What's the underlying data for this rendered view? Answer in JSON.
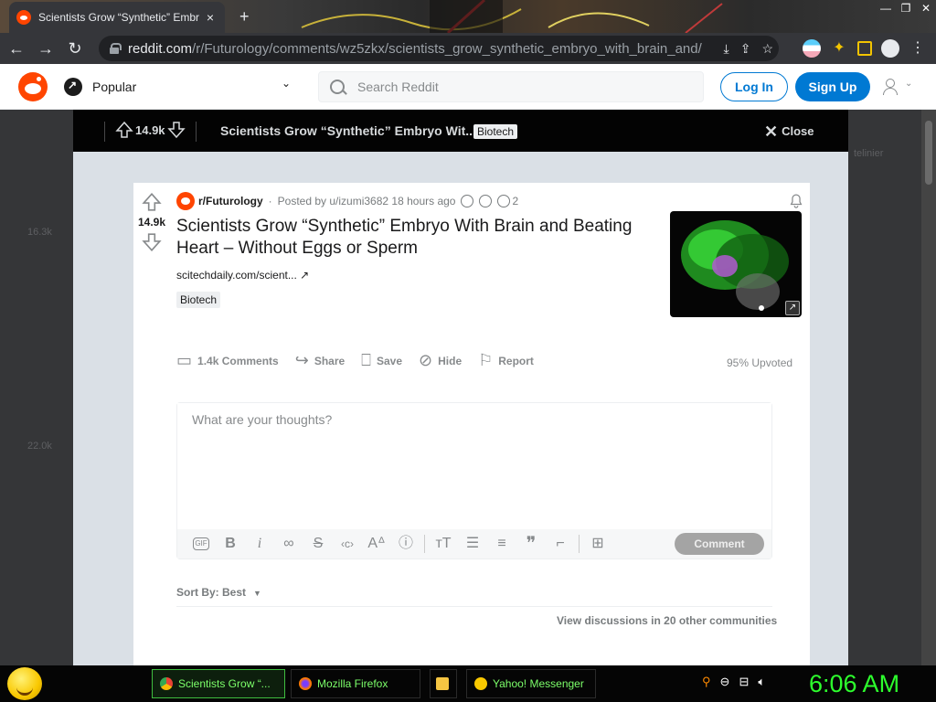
{
  "browser": {
    "tab_title": "Scientists Grow “Synthetic” Embr",
    "tab_close": "×",
    "new_tab": "+",
    "url_host": "reddit.com",
    "url_path": "/r/Futurology/comments/wz5zkx/scientists_grow_synthetic_embryo_with_brain_and/",
    "window_controls": [
      "—",
      "❐",
      "✕"
    ]
  },
  "header": {
    "feed_label": "Popular",
    "search_placeholder": "Search Reddit",
    "login": "Log In",
    "signup": "Sign Up"
  },
  "overlay": {
    "score": "14.9k",
    "title": "Scientists Grow “Synthetic” Embryo Wit...",
    "flair": "Biotech",
    "close": "Close"
  },
  "post": {
    "score": "14.9k",
    "subreddit": "r/Futurology",
    "posted_by": "Posted by u/izumi3682 18 hours ago",
    "award_count": "2",
    "title": "Scientists Grow “Synthetic” Embryo With Brain and Beating Heart – Without Eggs or Sperm",
    "link": "scitechdaily.com/scient...",
    "flair": "Biotech",
    "actions": {
      "comments": "1.4k Comments",
      "share": "Share",
      "save": "Save",
      "hide": "Hide",
      "report": "Report"
    },
    "upvoted": "95% Upvoted"
  },
  "comment_box": {
    "placeholder": "What are your thoughts?",
    "gif": "GIF",
    "submit": "Comment"
  },
  "sort": {
    "label": "Sort By: Best"
  },
  "view_discussions": "View discussions in 20 other communities",
  "background_ghosts": {
    "score_a": "16.3k",
    "score_b": "22.0k",
    "side_text": "telinier"
  },
  "taskbar": {
    "tasks": [
      {
        "label": "Scientists Grow “..."
      },
      {
        "label": "Mozilla Firefox"
      },
      {
        "label": "Yahoo! Messenger"
      }
    ],
    "clock": "6:06 AM"
  },
  "colors": {
    "reddit_orange": "#ff4500",
    "reddit_blue": "#0079d3",
    "clock_green": "#2dff2d"
  }
}
